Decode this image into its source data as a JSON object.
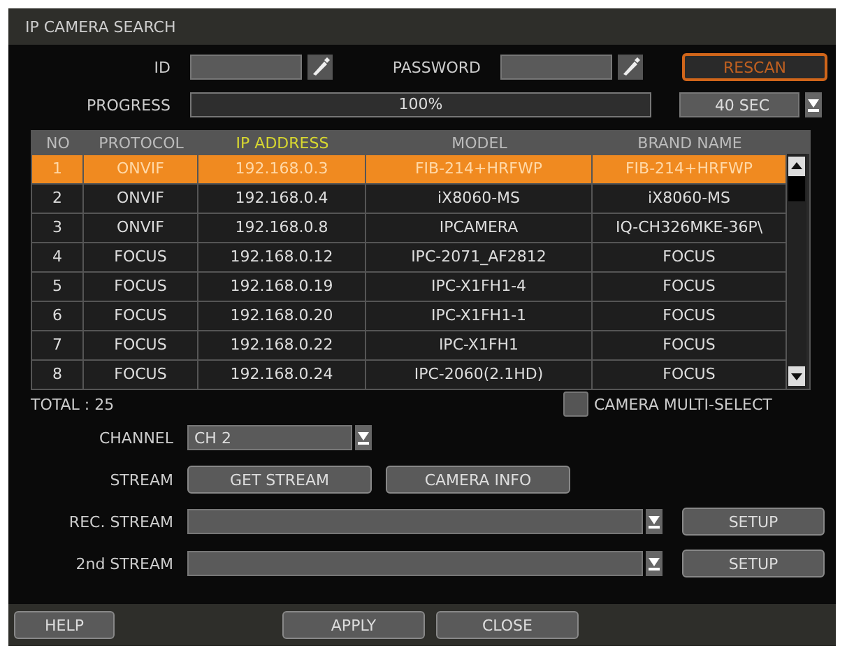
{
  "window": {
    "title": "IP CAMERA SEARCH"
  },
  "id_field": {
    "label": "ID"
  },
  "password_field": {
    "label": "PASSWORD"
  },
  "rescan_button": "RESCAN",
  "progress": {
    "label": "PROGRESS",
    "level": 1,
    "reading": "100%"
  },
  "timeout": {
    "value": "40 SEC"
  },
  "table": {
    "columns": [
      {
        "label": "NO",
        "highlighted": false
      },
      {
        "label": "PROTOCOL",
        "highlighted": false
      },
      {
        "label": "IP ADDRESS",
        "highlighted": true
      },
      {
        "label": "MODEL",
        "highlighted": false
      },
      {
        "label": "BRAND NAME",
        "highlighted": false
      }
    ],
    "rows": [
      {
        "no": "1",
        "protocol": "ONVIF",
        "ip": "192.168.0.3",
        "model": "FIB-214+HRFWP",
        "brand": "FIB-214+HRFWP",
        "selected": true
      },
      {
        "no": "2",
        "protocol": "ONVIF",
        "ip": "192.168.0.4",
        "model": "iX8060-MS",
        "brand": "iX8060-MS",
        "selected": false
      },
      {
        "no": "3",
        "protocol": "ONVIF",
        "ip": "192.168.0.8",
        "model": "IPCAMERA",
        "brand": "IQ-CH326MKE-36P\\",
        "selected": false
      },
      {
        "no": "4",
        "protocol": "FOCUS",
        "ip": "192.168.0.12",
        "model": "IPC-2071_AF2812",
        "brand": "FOCUS",
        "selected": false
      },
      {
        "no": "5",
        "protocol": "FOCUS",
        "ip": "192.168.0.19",
        "model": "IPC-X1FH1-4",
        "brand": "FOCUS",
        "selected": false
      },
      {
        "no": "6",
        "protocol": "FOCUS",
        "ip": "192.168.0.20",
        "model": "IPC-X1FH1-1",
        "brand": "FOCUS",
        "selected": false
      },
      {
        "no": "7",
        "protocol": "FOCUS",
        "ip": "192.168.0.22",
        "model": "IPC-X1FH1",
        "brand": "FOCUS",
        "selected": false
      },
      {
        "no": "8",
        "protocol": "FOCUS",
        "ip": "192.168.0.24",
        "model": "IPC-2060(2.1HD)",
        "brand": "FOCUS",
        "selected": false
      }
    ]
  },
  "total": "TOTAL : 25",
  "multi_select": {
    "label": "CAMERA MULTI-SELECT",
    "checked": false
  },
  "channel": {
    "label": "CHANNEL",
    "value": "CH 2"
  },
  "stream": {
    "label": "STREAM",
    "buttons": [
      "GET STREAM",
      "CAMERA INFO"
    ]
  },
  "rec_stream": {
    "label": "REC. STREAM",
    "button": "SETUP"
  },
  "second_stream": {
    "label": "2nd STREAM",
    "button": "SETUP"
  },
  "footer": {
    "help": "HELP",
    "buttons": [
      "APPLY",
      "CLOSE"
    ]
  }
}
